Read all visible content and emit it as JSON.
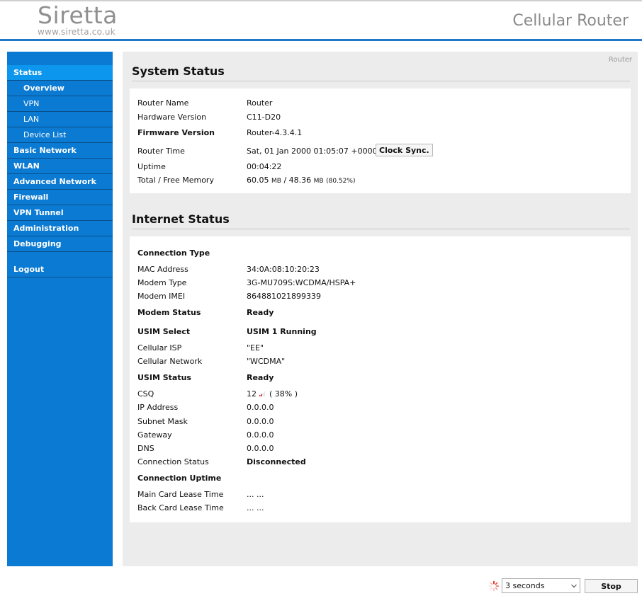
{
  "header": {
    "logo_name": "Siretta",
    "logo_url": "www.siretta.co.uk",
    "product_title": "Cellular Router"
  },
  "sidebar": {
    "items": [
      {
        "label": "Status",
        "level": 0,
        "active": true
      },
      {
        "label": "Overview",
        "level": 1,
        "active": true
      },
      {
        "label": "VPN",
        "level": 1
      },
      {
        "label": "LAN",
        "level": 1
      },
      {
        "label": "Device List",
        "level": 1
      },
      {
        "label": "Basic Network",
        "level": 0
      },
      {
        "label": "WLAN",
        "level": 0
      },
      {
        "label": "Advanced Network",
        "level": 0
      },
      {
        "label": "Firewall",
        "level": 0
      },
      {
        "label": "VPN Tunnel",
        "level": 0
      },
      {
        "label": "Administration",
        "level": 0
      },
      {
        "label": "Debugging",
        "level": 0
      }
    ],
    "logout": "Logout"
  },
  "breadcrumb": "Router",
  "system_status": {
    "title": "System Status",
    "router_name": {
      "label": "Router Name",
      "value": "Router"
    },
    "hardware_version": {
      "label": "Hardware Version",
      "value": "C11-D20"
    },
    "firmware_version": {
      "label": "Firmware Version",
      "value": "Router-4.3.4.1"
    },
    "router_time": {
      "label": "Router Time",
      "value": "Sat, 01 Jan 2000 01:05:07 +0000",
      "button": "Clock Sync."
    },
    "uptime": {
      "label": "Uptime",
      "value": "00:04:22"
    },
    "memory": {
      "label": "Total / Free Memory",
      "total": "60.05",
      "free": "48.36",
      "unit": "MB",
      "sep": " / ",
      "percent": "(80.52%)"
    }
  },
  "internet_status": {
    "title": "Internet Status",
    "connection_type": {
      "label": "Connection Type"
    },
    "mac_address": {
      "label": "MAC Address",
      "value": "34:0A:08:10:20:23"
    },
    "modem_type": {
      "label": "Modem Type",
      "value": "3G-MU709S:WCDMA/HSPA+"
    },
    "modem_imei": {
      "label": "Modem IMEI",
      "value": "864881021899339"
    },
    "modem_status": {
      "label": "Modem Status",
      "value": "Ready"
    },
    "usim_select": {
      "label": "USIM Select",
      "value": "USIM 1 Running"
    },
    "cellular_isp": {
      "label": "Cellular ISP",
      "value": "\"EE\""
    },
    "cellular_network": {
      "label": "Cellular Network",
      "value": "\"WCDMA\""
    },
    "usim_status": {
      "label": "USIM Status",
      "value": "Ready"
    },
    "csq": {
      "label": "CSQ",
      "value": "12",
      "percent": "( 38% )"
    },
    "ip_address": {
      "label": "IP Address",
      "value": "0.0.0.0"
    },
    "subnet_mask": {
      "label": "Subnet Mask",
      "value": "0.0.0.0"
    },
    "gateway": {
      "label": "Gateway",
      "value": "0.0.0.0"
    },
    "dns": {
      "label": "DNS",
      "value": "0.0.0.0"
    },
    "connection_status": {
      "label": "Connection Status",
      "value": "Disconnected"
    },
    "connection_uptime": {
      "label": "Connection Uptime"
    },
    "main_card_lease": {
      "label": "Main Card Lease Time",
      "value": "... ..."
    },
    "back_card_lease": {
      "label": "Back Card Lease Time",
      "value": "... ..."
    }
  },
  "footer": {
    "refresh_selected": "3 seconds",
    "stop_label": "Stop"
  },
  "icons": {
    "spinner": "loading-spinner-icon",
    "signal": "signal-bars-icon",
    "dropdown": "chevron-down-icon"
  },
  "colors": {
    "brand_blue": "#0b7ad2",
    "active_blue": "#0d96ee",
    "header_rule": "#1f78c8"
  }
}
